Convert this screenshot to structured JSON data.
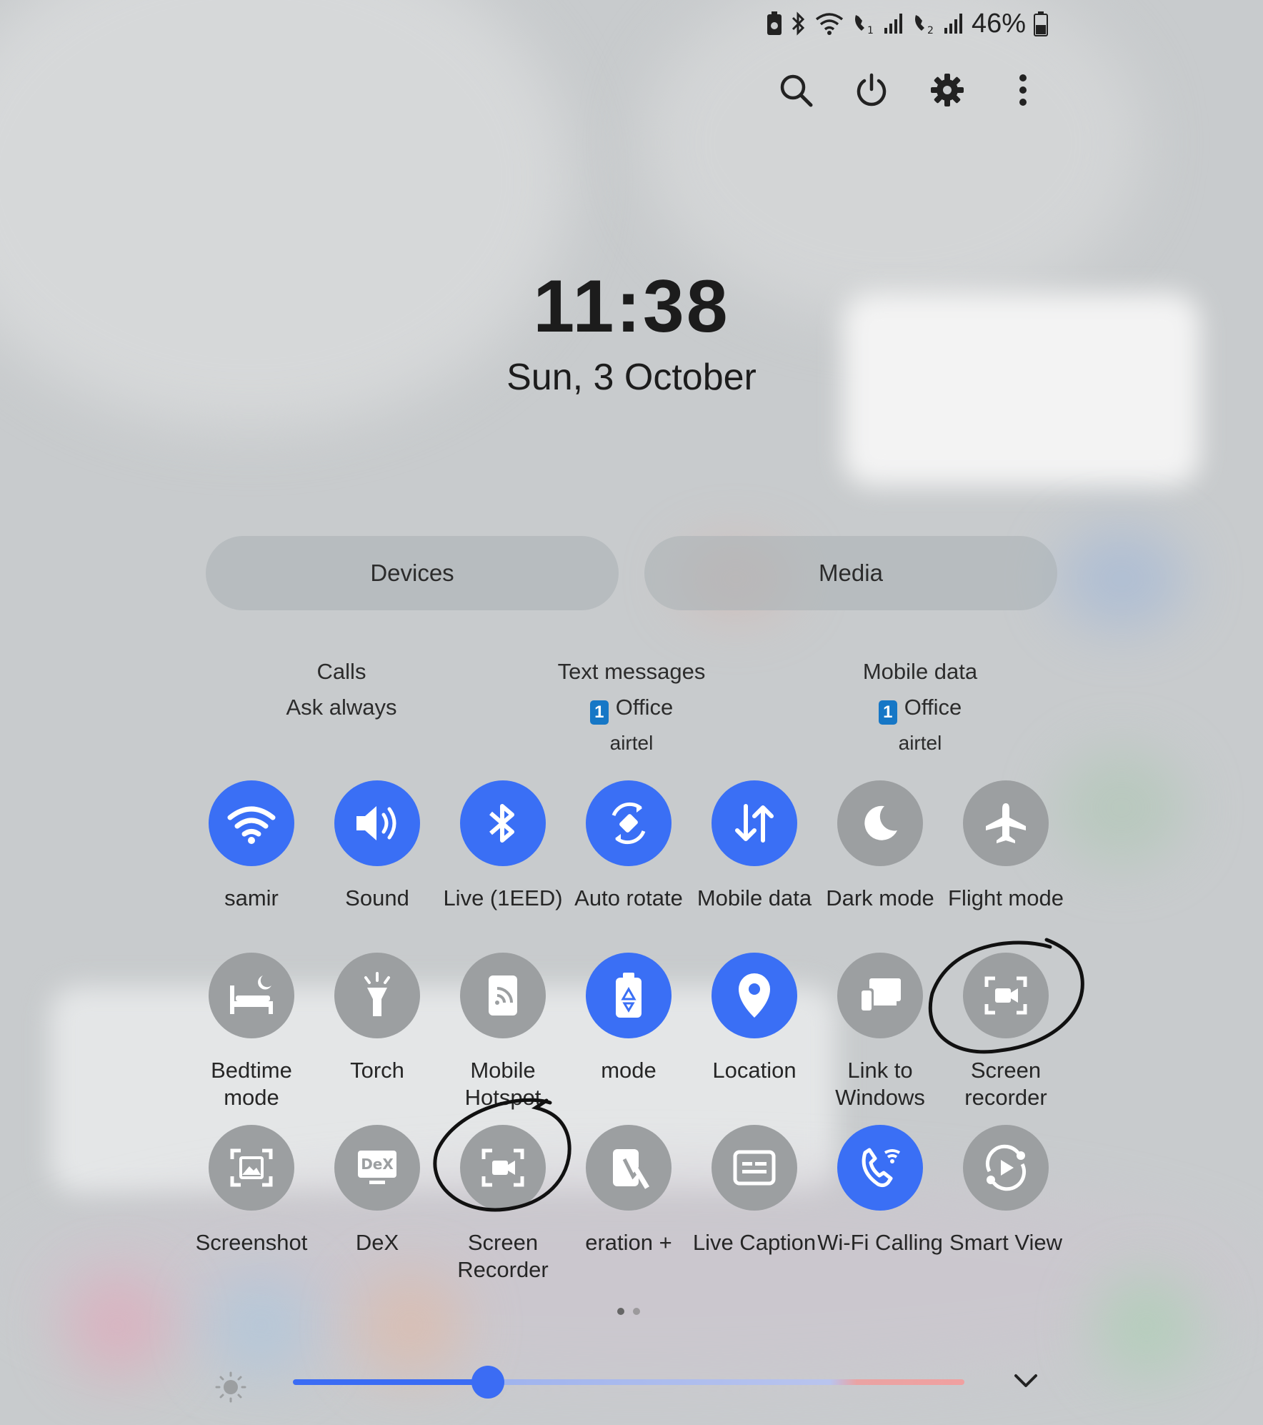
{
  "status_bar": {
    "battery_percent": "46%",
    "icons": [
      "battery-saver-icon",
      "bluetooth-icon",
      "wifi-icon",
      "volte-sim1-icon",
      "signal-sim1-icon",
      "volte-sim2-icon",
      "signal-sim2-icon",
      "battery-icon"
    ]
  },
  "top_actions": [
    "search-icon",
    "power-icon",
    "settings-gear-icon",
    "more-options-icon"
  ],
  "clock": {
    "time": "11:38",
    "date": "Sun, 3 October"
  },
  "buttons": {
    "devices": "Devices",
    "media": "Media"
  },
  "sim_info": {
    "calls": {
      "title": "Calls",
      "value": "Ask always"
    },
    "texts": {
      "title": "Text messages",
      "sim_badge": "1",
      "value": "Office",
      "carrier": "airtel"
    },
    "data": {
      "title": "Mobile data",
      "sim_badge": "1",
      "value": "Office",
      "carrier": "airtel"
    }
  },
  "tiles": [
    {
      "label": "samir",
      "icon": "wifi-icon",
      "on": true
    },
    {
      "label": "Sound",
      "icon": "sound-icon",
      "on": true
    },
    {
      "label": "Live (1EED)",
      "icon": "bluetooth-icon",
      "on": true
    },
    {
      "label": "Auto rotate",
      "icon": "auto-rotate-icon",
      "on": true
    },
    {
      "label": "Mobile data",
      "icon": "mobile-data-icon",
      "on": true
    },
    {
      "label": "Dark mode",
      "icon": "moon-icon",
      "on": false
    },
    {
      "label": "Flight mode",
      "icon": "airplane-icon",
      "on": false
    },
    {
      "label": "Bedtime mode",
      "icon": "bed-icon",
      "on": false
    },
    {
      "label": "Torch",
      "icon": "torch-icon",
      "on": false
    },
    {
      "label": "Mobile Hotspot",
      "icon": "hotspot-icon",
      "on": false
    },
    {
      "label": "mode",
      "icon": "power-saving-icon",
      "on": true
    },
    {
      "label": "Location",
      "icon": "location-pin-icon",
      "on": true
    },
    {
      "label": "Link to Windows",
      "icon": "link-windows-icon",
      "on": false
    },
    {
      "label": "Screen recorder",
      "icon": "screen-recorder-icon",
      "on": false
    },
    {
      "label": "Screenshot",
      "icon": "screenshot-icon",
      "on": false
    },
    {
      "label": "DeX",
      "icon": "dex-icon",
      "on": false
    },
    {
      "label": "Screen Recorder",
      "icon": "screen-recorder-icon",
      "on": false
    },
    {
      "label": "eration +",
      "icon": "nfc-icon",
      "on": false
    },
    {
      "label": "Live Caption",
      "icon": "caption-icon",
      "on": false
    },
    {
      "label": "Wi-Fi Calling",
      "icon": "wifi-calling-icon",
      "on": true
    },
    {
      "label": "Smart View",
      "icon": "smart-view-icon",
      "on": false
    }
  ],
  "dex_text": "DeX",
  "page_indicator": {
    "current": 1,
    "total": 2
  },
  "brightness": {
    "level_fraction": 0.29,
    "icon": "brightness-sun-icon"
  },
  "expand_icon": "chevron-down-icon",
  "colors": {
    "tile_on": "#3a6ff5",
    "tile_off": "#9c9fa1",
    "annotation": "#111111"
  }
}
